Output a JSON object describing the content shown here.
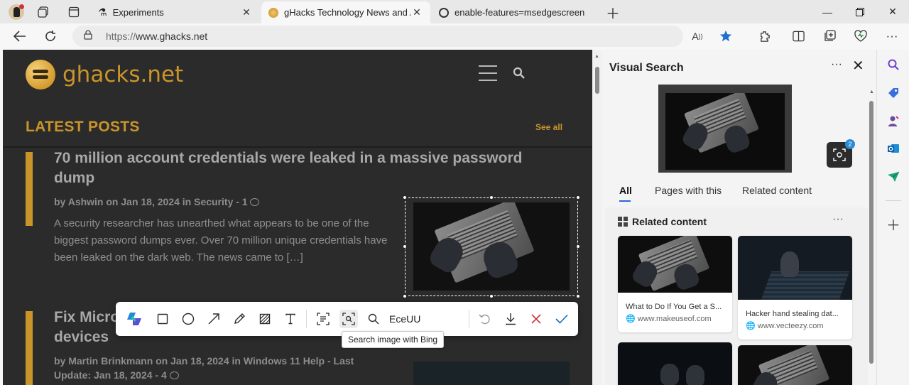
{
  "tabs": [
    {
      "label": "Experiments",
      "icon": "flask-icon",
      "active": false
    },
    {
      "label": "gHacks Technology News and Ad",
      "icon": "ghacks-favicon",
      "active": true
    },
    {
      "label": "enable-features=msedgescreen",
      "icon": "edge-favicon",
      "active": false
    }
  ],
  "address": {
    "protocol": "https://",
    "host": "www.ghacks.net"
  },
  "site": {
    "logo_text_main": "ghacks",
    "logo_text_tld": ".net",
    "section_title": "LATEST POSTS",
    "see_all": "See all",
    "posts": [
      {
        "title_line1": "70 million account credentials were leaked in a massive password",
        "title_line2": "dump",
        "meta": "by Ashwin on Jan 18, 2024 in Security - 1",
        "excerpt": "A security researcher has unearthed what appears to be one of the biggest password dumps ever. Over 70 million unique credentials have been leaked on the dark web. The news came to […]"
      },
      {
        "title_line1": "Fix Micro",
        "title_line2": "devices",
        "meta_line1": "by Martin Brinkmann on Jan 18, 2024 in Windows 11 Help - Last",
        "meta_line2": "Update: Jan 18, 2024 - 4"
      }
    ]
  },
  "capture_toolbar": {
    "input_value": "EceUU",
    "tooltip": "Search image with Bing"
  },
  "visual_search": {
    "title": "Visual Search",
    "lens_badge": "2",
    "tabs": [
      "All",
      "Pages with this",
      "Related content"
    ],
    "related_title": "Related content",
    "cards": [
      {
        "title": "What to Do If You Get a S...",
        "source": "www.makeuseof.com"
      },
      {
        "title": "Hacker hand stealing dat...",
        "source": "www.vecteezy.com"
      }
    ]
  },
  "colors": {
    "accent_gold": "#c9952a",
    "edge_blue": "#1f6fd1",
    "cancel_red": "#d13438",
    "confirm_blue": "#0f6cbd"
  }
}
